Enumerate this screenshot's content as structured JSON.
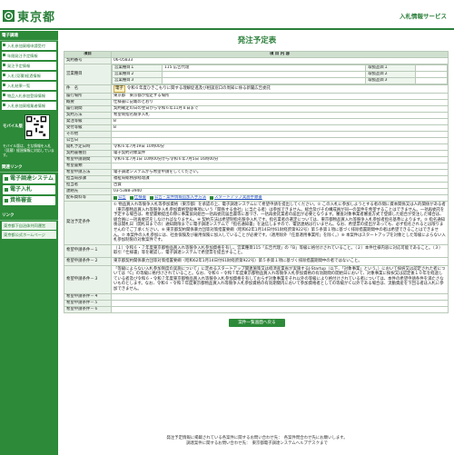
{
  "header": {
    "logo_text": "東京都",
    "site_name": "入札情報サービス"
  },
  "sidebar": {
    "section1": "電子調達",
    "menu": [
      "入札参加資格申請受付",
      "年間発注予定情報",
      "発注予定情報",
      "入札(見積)経過情報",
      "入札結果一覧",
      "物品入札参加登録情報",
      "入札参加資格業者情報"
    ],
    "qr_label": "モバイル版",
    "qr_note": "モバイル版は、主な情報を入札（見積）経過情報に対応しています。",
    "section2": "関連リンク",
    "tabs": [
      "電子調達システム(TOP)",
      "電子入札",
      "資格審査"
    ],
    "section3": "リンク",
    "links": [
      "東京都下自治体共同運営",
      "東京都公式ホームページ"
    ]
  },
  "main": {
    "title": "発注予定表",
    "header_item": "項目",
    "header_content": "項 目 内 容",
    "rows": {
      "no_label": "契約番号",
      "no_value": "06-05833",
      "biz_label": "営業種目",
      "biz": [
        {
          "k": "営業種目１",
          "v": "115 広告代理",
          "k2": "取扱品目１",
          "v2": ""
        },
        {
          "k": "営業種目２",
          "v": "",
          "k2": "取扱品目２",
          "v2": ""
        },
        {
          "k": "営業種目３",
          "v": "",
          "k2": "取扱品目３",
          "v2": ""
        }
      ],
      "name_label": "件　名",
      "name_tag": "電子",
      "name_value": "令和６年度ひきこもりに関する理解促進及び相談窓口の周知に係る新聞広告委託",
      "place_label": "履行場所",
      "place_value": "東京都　東京都が指定する場所",
      "summary_label": "概要",
      "summary_value": "仕様書に記載のとおり",
      "period_label": "履行期間",
      "period_value": "契約確定の日の翌日から令和６年11月８日まで",
      "method_label": "契約方法",
      "method_value": "希望制指名競争入札",
      "ordertype_label": "発注等級",
      "ordertype_value": "B",
      "acctype_label": "受付等級",
      "acctype_value": "B",
      "other_label": "その他",
      "other_value": "",
      "pubdate_label": "公告日",
      "pubdate_value": "",
      "pubdate2_label": "開札予定日時",
      "pubdate2_value": "令和６年7月19日 10時00分",
      "contracttype_label": "契約書種別",
      "contracttype_value": "電子契約対象案件",
      "apply_label": "希望申請期間",
      "apply_value": "令和６年7月1日 10時00分から令和６年7月5日 16時00分",
      "hopetype_label": "希望書類",
      "hopetype_value": "",
      "hopemethod_label": "希望申請方法",
      "hopemethod_value": "電子調達システムから希望申請をしてください。",
      "dept_label": "担当局部課",
      "dept_value": "福祉局総務部経理課",
      "person_label": "担当者",
      "person_value": "古賀",
      "tel_label": "連絡先",
      "tel_value": "03-5388-3940",
      "docs_label": "配布資料等",
      "docs": [
        "公告",
        "仕様書",
        "公告・案件情報追加入手方法",
        "スタートアップ実施手順書"
      ],
      "cond_label": "発注予定条件",
      "cond_value": "① 物品買入れ等競争入札等参加資格（東京都）を承認の上、電子調達システムにて希望申請を提出してください。② この入札に参加しようとする者の間に資本関係又は人的関係がある者（東京都物品買入れ等競争入札参加資格登録事項にいう「関係する会社」に当たる者）は参加できません。総合及びその構成員が同一の案件を希望することはできません。一括再委託を予定する場合は、希望書類提出の際に事業協同組合一括再委託届出書等に基づき、一括再委託業者の届出が必要となります。審査対象事業者審査方式で登録した組合が受注した場合は、組合員に一括再委託をしなければなりません。④ 契約方法は希望制指名競争入札です。指名業者の選定については、東京都物品買入れ等競争入札参加者指名基準によります。⑤ 指名通知後は開札日（開札日までの）通知期限までに電子調達システムで「指名通知書」を送信しますので、電話連絡は行いません。なお、希望票の提出があっても、必ず指名されるとは限りませんのでご了承ください。⑥ 東京都契約関係暴力団等対策措置要綱（昭和62年1月14日付61財経庶第922号）第５条第１項に基づく排除措置期間中の者は希望できることはできません。⑦ 本案件の入札参加には、社会保険及び雇用保険に加入していることが必要です。（適用除外「任意適用事業所」を除く。）⑧ 本案件はスタートアップを対象とした等級によらない入札参加制限の対象案件です。",
      "req_label_1": "希望申請条件－１",
      "req_value_1": "（１）令和６・７年度東京都物品買入れ等競争入札参加資格を有し、営業種目115「広告代理」の「B」等級に格付けされていること。（２）本件仕様内容に対応可能であること。（３）取引「仕様書」等を確認し、電子調達システムで希望票を提出すること。",
      "req_label_2": "希望申請条件－２",
      "req_value_2": "東京都契約関係暴力団等対策措置要綱（昭和62年1月14日付61財経庶第922号）第５条第１項に基づく排除措置期間中の者ではないこと。",
      "req_label_3": "希望申請条件－３",
      "req_value_3": "「等級によらない入札参加制度の実施について」に定めるスタートアップ関連施策又は経済産業省が実施するJ-Startup（以下、「対象事業」という。）において採択又は認定された者については「C」の等級に格付けされていること。なお、令和６・令和７年度東京都物品買入れ等競争入札参加資格の有効期間の開始日において、対象事業に採択又は認定後１０年を経過している者及び令和６・令和７年度東京都物品買入れ等競争入札参加資格を有しておらず対象事業をそれ以外の等級により格付けされている者については、本件の希望申請条件を満たさないものとします。なお、令和６・令和７年度東京都物品買入れ等競争入札参加資格の有効期間内において参加資格者としての等級がＣ以外である場合は、流動資産を下回る者は入札に参加できません。",
      "req_label_4": "希望申請条件－４",
      "req_value_4": "",
      "req_label_5": "希望申請条件－５",
      "req_value_5": "",
      "req_label_6": "希望申請条件－６",
      "req_value_6": ""
    },
    "back_button": "案件一覧画面へ戻る"
  },
  "footer": {
    "line1": "発注予定情報に掲載されている各案件に関するお問い合わせ先：　各案件問合わせ先にお願いします。",
    "line2": "調達案件に関するお問い合わせ先：　東京都電子調達システムヘルプデスクまで"
  }
}
